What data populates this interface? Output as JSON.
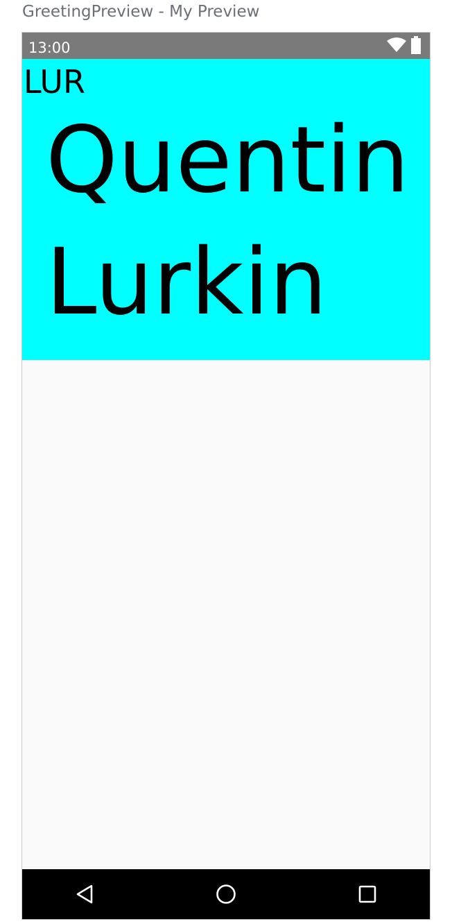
{
  "window": {
    "title": "GreetingPreview - My Preview"
  },
  "status_bar": {
    "time": "13:00",
    "background": "#7a7a7a",
    "icons": [
      "wifi-icon",
      "battery-icon"
    ]
  },
  "content": {
    "background": "#00ffff",
    "initials": "LUR",
    "first_name": "Quentin",
    "last_name": "Lurkin"
  },
  "nav_bar": {
    "background": "#000000",
    "buttons": [
      "back-button",
      "home-button",
      "recents-button"
    ]
  }
}
